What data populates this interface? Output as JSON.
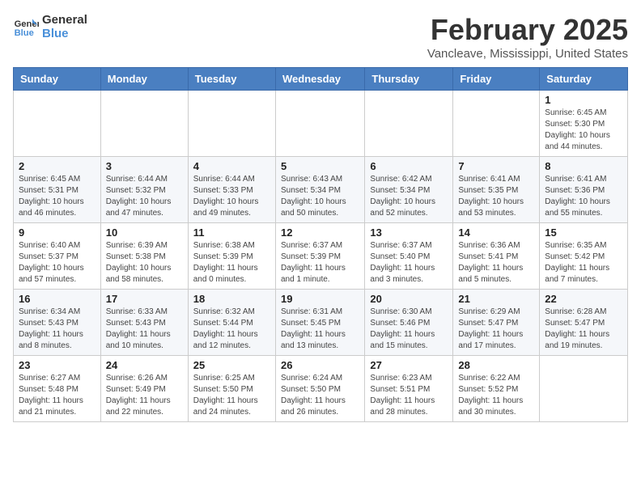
{
  "header": {
    "logo_line1": "General",
    "logo_line2": "Blue",
    "month": "February 2025",
    "location": "Vancleave, Mississippi, United States"
  },
  "days_of_week": [
    "Sunday",
    "Monday",
    "Tuesday",
    "Wednesday",
    "Thursday",
    "Friday",
    "Saturday"
  ],
  "weeks": [
    [
      {
        "day": "",
        "info": ""
      },
      {
        "day": "",
        "info": ""
      },
      {
        "day": "",
        "info": ""
      },
      {
        "day": "",
        "info": ""
      },
      {
        "day": "",
        "info": ""
      },
      {
        "day": "",
        "info": ""
      },
      {
        "day": "1",
        "info": "Sunrise: 6:45 AM\nSunset: 5:30 PM\nDaylight: 10 hours and 44 minutes."
      }
    ],
    [
      {
        "day": "2",
        "info": "Sunrise: 6:45 AM\nSunset: 5:31 PM\nDaylight: 10 hours and 46 minutes."
      },
      {
        "day": "3",
        "info": "Sunrise: 6:44 AM\nSunset: 5:32 PM\nDaylight: 10 hours and 47 minutes."
      },
      {
        "day": "4",
        "info": "Sunrise: 6:44 AM\nSunset: 5:33 PM\nDaylight: 10 hours and 49 minutes."
      },
      {
        "day": "5",
        "info": "Sunrise: 6:43 AM\nSunset: 5:34 PM\nDaylight: 10 hours and 50 minutes."
      },
      {
        "day": "6",
        "info": "Sunrise: 6:42 AM\nSunset: 5:34 PM\nDaylight: 10 hours and 52 minutes."
      },
      {
        "day": "7",
        "info": "Sunrise: 6:41 AM\nSunset: 5:35 PM\nDaylight: 10 hours and 53 minutes."
      },
      {
        "day": "8",
        "info": "Sunrise: 6:41 AM\nSunset: 5:36 PM\nDaylight: 10 hours and 55 minutes."
      }
    ],
    [
      {
        "day": "9",
        "info": "Sunrise: 6:40 AM\nSunset: 5:37 PM\nDaylight: 10 hours and 57 minutes."
      },
      {
        "day": "10",
        "info": "Sunrise: 6:39 AM\nSunset: 5:38 PM\nDaylight: 10 hours and 58 minutes."
      },
      {
        "day": "11",
        "info": "Sunrise: 6:38 AM\nSunset: 5:39 PM\nDaylight: 11 hours and 0 minutes."
      },
      {
        "day": "12",
        "info": "Sunrise: 6:37 AM\nSunset: 5:39 PM\nDaylight: 11 hours and 1 minute."
      },
      {
        "day": "13",
        "info": "Sunrise: 6:37 AM\nSunset: 5:40 PM\nDaylight: 11 hours and 3 minutes."
      },
      {
        "day": "14",
        "info": "Sunrise: 6:36 AM\nSunset: 5:41 PM\nDaylight: 11 hours and 5 minutes."
      },
      {
        "day": "15",
        "info": "Sunrise: 6:35 AM\nSunset: 5:42 PM\nDaylight: 11 hours and 7 minutes."
      }
    ],
    [
      {
        "day": "16",
        "info": "Sunrise: 6:34 AM\nSunset: 5:43 PM\nDaylight: 11 hours and 8 minutes."
      },
      {
        "day": "17",
        "info": "Sunrise: 6:33 AM\nSunset: 5:43 PM\nDaylight: 11 hours and 10 minutes."
      },
      {
        "day": "18",
        "info": "Sunrise: 6:32 AM\nSunset: 5:44 PM\nDaylight: 11 hours and 12 minutes."
      },
      {
        "day": "19",
        "info": "Sunrise: 6:31 AM\nSunset: 5:45 PM\nDaylight: 11 hours and 13 minutes."
      },
      {
        "day": "20",
        "info": "Sunrise: 6:30 AM\nSunset: 5:46 PM\nDaylight: 11 hours and 15 minutes."
      },
      {
        "day": "21",
        "info": "Sunrise: 6:29 AM\nSunset: 5:47 PM\nDaylight: 11 hours and 17 minutes."
      },
      {
        "day": "22",
        "info": "Sunrise: 6:28 AM\nSunset: 5:47 PM\nDaylight: 11 hours and 19 minutes."
      }
    ],
    [
      {
        "day": "23",
        "info": "Sunrise: 6:27 AM\nSunset: 5:48 PM\nDaylight: 11 hours and 21 minutes."
      },
      {
        "day": "24",
        "info": "Sunrise: 6:26 AM\nSunset: 5:49 PM\nDaylight: 11 hours and 22 minutes."
      },
      {
        "day": "25",
        "info": "Sunrise: 6:25 AM\nSunset: 5:50 PM\nDaylight: 11 hours and 24 minutes."
      },
      {
        "day": "26",
        "info": "Sunrise: 6:24 AM\nSunset: 5:50 PM\nDaylight: 11 hours and 26 minutes."
      },
      {
        "day": "27",
        "info": "Sunrise: 6:23 AM\nSunset: 5:51 PM\nDaylight: 11 hours and 28 minutes."
      },
      {
        "day": "28",
        "info": "Sunrise: 6:22 AM\nSunset: 5:52 PM\nDaylight: 11 hours and 30 minutes."
      },
      {
        "day": "",
        "info": ""
      }
    ]
  ]
}
